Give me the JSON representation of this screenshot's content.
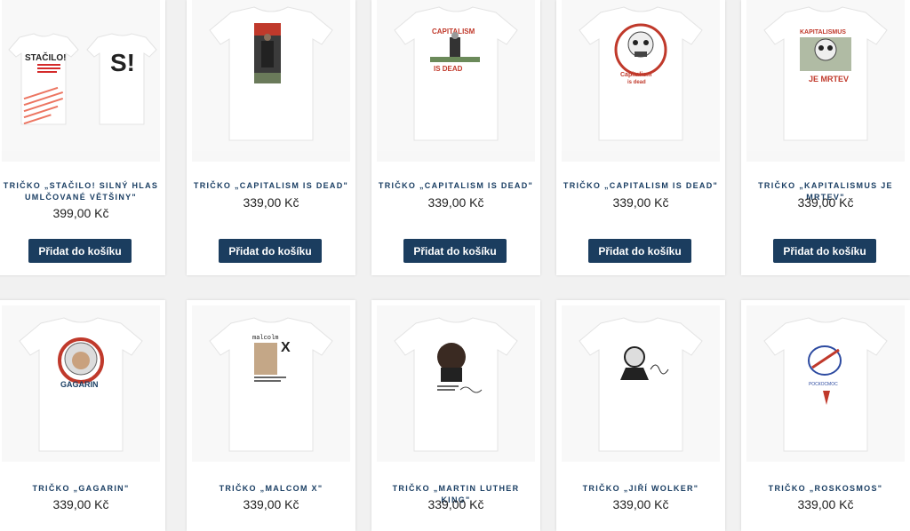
{
  "products": [
    {
      "title": "Tričko „Stačilo! Silný hlas umlčované většiny\"",
      "price": "399,00 Kč",
      "button": "Přidat do košíku",
      "print": "stacilo"
    },
    {
      "title": "Tričko „Capitalism is dead\"",
      "price": "339,00 Kč",
      "button": "Přidat do košíku",
      "print": "poster"
    },
    {
      "title": "Tričko „Capitalism is dead\"",
      "price": "339,00 Kč",
      "button": "Přidat do košíku",
      "print": "capitalism-red",
      "print_text": [
        "CAPITALISM",
        "IS DEAD"
      ]
    },
    {
      "title": "Tričko „Capitalism is dead\"",
      "price": "339,00 Kč",
      "button": "Přidat do košíku",
      "print": "skull-circle",
      "print_text": [
        "Capitalism",
        "is dead"
      ]
    },
    {
      "title": "Tričko „Kapitalismus je mrtev\"",
      "price": "339,00 Kč",
      "button": "Přidat do košíku",
      "print": "skull-money",
      "print_text": [
        "KAPITALISMUS",
        "JE MRTEV"
      ]
    },
    {
      "title": "Tričko „Gagarin\"",
      "price": "339,00 Kč",
      "print": "gagarin",
      "print_text": [
        "GAGARIN"
      ]
    },
    {
      "title": "Tričko „Malcom X\"",
      "price": "339,00 Kč",
      "print": "malcolm",
      "print_text": [
        "malcolm",
        "X"
      ]
    },
    {
      "title": "Tričko „Martin Luther King\"",
      "price": "339,00 Kč",
      "print": "mlk"
    },
    {
      "title": "Tričko „Jiří Wolker\"",
      "price": "339,00 Kč",
      "print": "wolker"
    },
    {
      "title": "Tričko „Roskosmos\"",
      "price": "339,00 Kč",
      "print": "roskosmos",
      "print_text": [
        "РОСКОСМОС"
      ]
    }
  ],
  "print_extra": {
    "stacilo_front": "STAČILO!",
    "stacilo_back": "S!"
  },
  "colors": {
    "button_bg": "#1b3d5f",
    "title_color": "#1a3e63",
    "accent_red": "#d42a2a"
  }
}
